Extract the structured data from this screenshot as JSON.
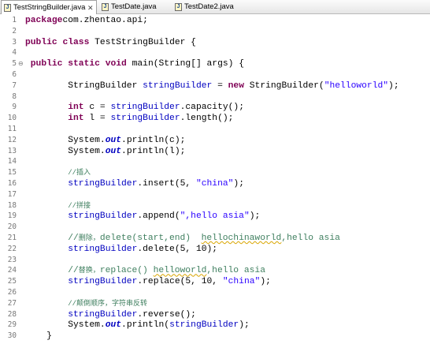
{
  "tabs": [
    {
      "label": "TestStringBuilder.java",
      "close": "✕",
      "active": true
    },
    {
      "label": "TestDate.java",
      "active": false
    },
    {
      "label": "TestDate2.java",
      "active": false
    }
  ],
  "gutter": {
    "fold_marker": "⊖"
  },
  "lines": [
    {
      "n": "1",
      "code": [
        [
          "kw",
          "package"
        ],
        [
          "",
          "com.zhentao.api;"
        ]
      ]
    },
    {
      "n": "2",
      "code": []
    },
    {
      "n": "3",
      "code": [
        [
          "kw",
          "public"
        ],
        [
          "",
          " "
        ],
        [
          "kw",
          "class"
        ],
        [
          "",
          " TestStringBuilder {"
        ]
      ]
    },
    {
      "n": "4",
      "code": []
    },
    {
      "n": "5",
      "fold": true,
      "code": [
        [
          "",
          " "
        ],
        [
          "kw",
          "public"
        ],
        [
          "",
          " "
        ],
        [
          "kw",
          "static"
        ],
        [
          "",
          " "
        ],
        [
          "kw",
          "void"
        ],
        [
          "",
          " main(String[] args) {"
        ]
      ]
    },
    {
      "n": "6",
      "code": []
    },
    {
      "n": "7",
      "code": [
        [
          "",
          "        StringBuilder "
        ],
        [
          "fld",
          "stringBuilder"
        ],
        [
          "",
          " = "
        ],
        [
          "kw",
          "new"
        ],
        [
          "",
          " StringBuilder("
        ],
        [
          "str",
          "\"helloworld\""
        ],
        [
          "",
          ");"
        ]
      ]
    },
    {
      "n": "8",
      "code": []
    },
    {
      "n": "9",
      "code": [
        [
          "",
          "        "
        ],
        [
          "kw",
          "int"
        ],
        [
          "",
          " c = "
        ],
        [
          "fld",
          "stringBuilder"
        ],
        [
          "",
          ".capacity();"
        ]
      ]
    },
    {
      "n": "10",
      "code": [
        [
          "",
          "        "
        ],
        [
          "kw",
          "int"
        ],
        [
          "",
          " l = "
        ],
        [
          "fld",
          "stringBuilder"
        ],
        [
          "",
          ".length();"
        ]
      ]
    },
    {
      "n": "11",
      "code": []
    },
    {
      "n": "12",
      "code": [
        [
          "",
          "        System."
        ],
        [
          "sfld",
          "out"
        ],
        [
          "",
          ".println(c);"
        ]
      ]
    },
    {
      "n": "13",
      "code": [
        [
          "",
          "        System."
        ],
        [
          "sfld",
          "out"
        ],
        [
          "",
          ".println(l);"
        ]
      ]
    },
    {
      "n": "14",
      "code": []
    },
    {
      "n": "15",
      "code": [
        [
          "",
          "        "
        ],
        [
          "cmt small",
          "//插入"
        ]
      ]
    },
    {
      "n": "16",
      "code": [
        [
          "",
          "        "
        ],
        [
          "fld",
          "stringBuilder"
        ],
        [
          "",
          ".insert(5, "
        ],
        [
          "str",
          "\"china\""
        ],
        [
          "",
          ");"
        ]
      ]
    },
    {
      "n": "17",
      "code": []
    },
    {
      "n": "18",
      "code": [
        [
          "",
          "        "
        ],
        [
          "cmt small",
          "//拼接"
        ]
      ]
    },
    {
      "n": "19",
      "code": [
        [
          "",
          "        "
        ],
        [
          "fld",
          "stringBuilder"
        ],
        [
          "",
          ".append("
        ],
        [
          "str",
          "\",hello asia\""
        ],
        [
          "",
          ");"
        ]
      ]
    },
    {
      "n": "20",
      "code": []
    },
    {
      "n": "21",
      "code": [
        [
          "",
          "        "
        ],
        [
          "cmt",
          "//"
        ],
        [
          "cmt small",
          "删除，"
        ],
        [
          "cmt",
          "delete(start,end)  "
        ],
        [
          "cmt sq",
          "hellochinaworld"
        ],
        [
          "cmt",
          ",hello asia"
        ]
      ]
    },
    {
      "n": "22",
      "code": [
        [
          "",
          "        "
        ],
        [
          "fld",
          "stringBuilder"
        ],
        [
          "",
          ".delete(5, 10);"
        ]
      ]
    },
    {
      "n": "23",
      "code": []
    },
    {
      "n": "24",
      "code": [
        [
          "",
          "        "
        ],
        [
          "cmt",
          "//"
        ],
        [
          "cmt small",
          "替换，"
        ],
        [
          "cmt",
          "replace() "
        ],
        [
          "cmt sq",
          "helloworld"
        ],
        [
          "cmt",
          ",hello asia"
        ]
      ]
    },
    {
      "n": "25",
      "code": [
        [
          "",
          "        "
        ],
        [
          "fld",
          "stringBuilder"
        ],
        [
          "",
          ".replace(5, 10, "
        ],
        [
          "str",
          "\"china\""
        ],
        [
          "",
          ");"
        ]
      ]
    },
    {
      "n": "26",
      "code": []
    },
    {
      "n": "27",
      "code": [
        [
          "",
          "        "
        ],
        [
          "cmt small",
          "//颠倒顺序，字符串反转"
        ]
      ]
    },
    {
      "n": "28",
      "code": [
        [
          "",
          "        "
        ],
        [
          "fld",
          "stringBuilder"
        ],
        [
          "",
          ".reverse();"
        ]
      ]
    },
    {
      "n": "29",
      "code": [
        [
          "",
          "        System."
        ],
        [
          "sfld",
          "out"
        ],
        [
          "",
          ".println("
        ],
        [
          "fld",
          "stringBuilder"
        ],
        [
          "",
          ");"
        ]
      ]
    },
    {
      "n": "30",
      "code": [
        [
          "",
          "    }"
        ]
      ]
    }
  ]
}
